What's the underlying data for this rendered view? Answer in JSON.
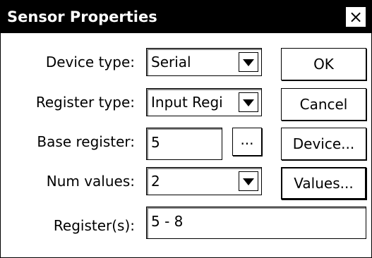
{
  "window": {
    "title": "Sensor Properties",
    "close_glyph": "×"
  },
  "fields": {
    "device_type": {
      "label": "Device type:",
      "value": "Serial"
    },
    "register_type": {
      "label": "Register type:",
      "value": "Input Regi"
    },
    "base_register": {
      "label": "Base register:",
      "value": "5",
      "browse_label": "..."
    },
    "num_values": {
      "label": "Num values:",
      "value": "2"
    },
    "registers": {
      "label": "Register(s):",
      "value": "5 - 8"
    }
  },
  "buttons": {
    "ok": "OK",
    "cancel": "Cancel",
    "device": "Device...",
    "values": "Values..."
  },
  "icons": {
    "close": "close-icon",
    "dropdown": "chevron-down-icon"
  }
}
